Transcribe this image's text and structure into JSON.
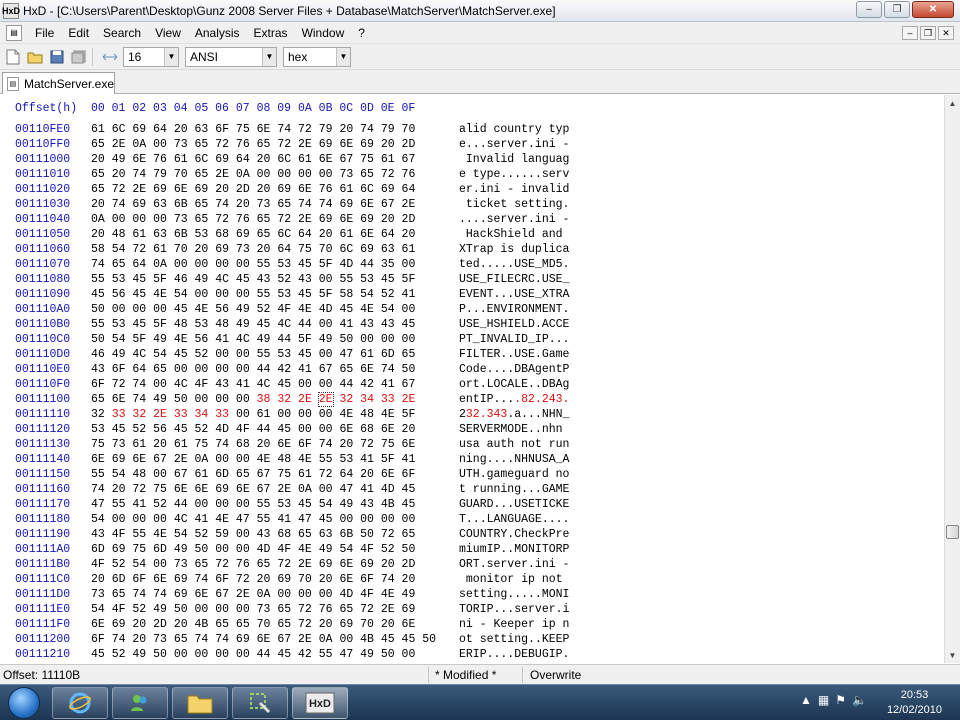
{
  "window": {
    "app_icon": "HxD",
    "title": "HxD - [C:\\Users\\Parent\\Desktop\\Gunz 2008 Server Files + Database\\MatchServer\\MatchServer.exe]",
    "buttons": {
      "minimize": "–",
      "maximize": "❐",
      "close": "✕"
    }
  },
  "menu": {
    "items": [
      "File",
      "Edit",
      "Search",
      "View",
      "Analysis",
      "Extras",
      "Window",
      "?"
    ],
    "mdi_buttons": {
      "minimize": "–",
      "restore": "❐",
      "close": "✕"
    }
  },
  "toolbar": {
    "bytes_per_row": "16",
    "charset": "ANSI",
    "base": "hex"
  },
  "tab": {
    "label": "MatchServer.exe"
  },
  "hex_view": {
    "header_offset": "Offset(h)",
    "header_columns": "00 01 02 03 04 05 06 07 08 09 0A 0B 0C 0D 0E 0F",
    "rows": [
      {
        "offset": "00110FE0",
        "hex": "61 6C 69 64 20 63 6F 75 6E 74 72 79 20 74 79 70",
        "ascii": "alid country typ"
      },
      {
        "offset": "00110FF0",
        "hex": "65 2E 0A 00 73 65 72 76 65 72 2E 69 6E 69 20 2D",
        "ascii": "e...server.ini -"
      },
      {
        "offset": "00111000",
        "hex": "20 49 6E 76 61 6C 69 64 20 6C 61 6E 67 75 61 67",
        "ascii": " Invalid languag"
      },
      {
        "offset": "00111010",
        "hex": "65 20 74 79 70 65 2E 0A 00 00 00 00 73 65 72 76",
        "ascii": "e type......serv"
      },
      {
        "offset": "00111020",
        "hex": "65 72 2E 69 6E 69 20 2D 20 69 6E 76 61 6C 69 64",
        "ascii": "er.ini - invalid"
      },
      {
        "offset": "00111030",
        "hex": "20 74 69 63 6B 65 74 20 73 65 74 74 69 6E 67 2E",
        "ascii": " ticket setting."
      },
      {
        "offset": "00111040",
        "hex": "0A 00 00 00 73 65 72 76 65 72 2E 69 6E 69 20 2D",
        "ascii": "....server.ini -"
      },
      {
        "offset": "00111050",
        "hex": "20 48 61 63 6B 53 68 69 65 6C 64 20 61 6E 64 20",
        "ascii": " HackShield and "
      },
      {
        "offset": "00111060",
        "hex": "58 54 72 61 70 20 69 73 20 64 75 70 6C 69 63 61",
        "ascii": "XTrap is duplica"
      },
      {
        "offset": "00111070",
        "hex": "74 65 64 0A 00 00 00 00 55 53 45 5F 4D 44 35 00",
        "ascii": "ted.....USE_MD5."
      },
      {
        "offset": "00111080",
        "hex": "55 53 45 5F 46 49 4C 45 43 52 43 00 55 53 45 5F",
        "ascii": "USE_FILECRC.USE_"
      },
      {
        "offset": "00111090",
        "hex": "45 56 45 4E 54 00 00 00 55 53 45 5F 58 54 52 41",
        "ascii": "EVENT...USE_XTRA"
      },
      {
        "offset": "001110A0",
        "hex": "50 00 00 00 45 4E 56 49 52 4F 4E 4D 45 4E 54 00",
        "ascii": "P...ENVIRONMENT."
      },
      {
        "offset": "001110B0",
        "hex": "55 53 45 5F 48 53 48 49 45 4C 44 00 41 43 43 45",
        "ascii": "USE_HSHIELD.ACCE"
      },
      {
        "offset": "001110C0",
        "hex": "50 54 5F 49 4E 56 41 4C 49 44 5F 49 50 00 00 00",
        "ascii": "PT_INVALID_IP..."
      },
      {
        "offset": "001110D0",
        "hex": "46 49 4C 54 45 52 00 00 55 53 45 00 47 61 6D 65",
        "ascii": "FILTER..USE.Game"
      },
      {
        "offset": "001110E0",
        "hex": "43 6F 64 65 00 00 00 00 44 42 41 67 65 6E 74 50",
        "ascii": "Code....DBAgentP"
      },
      {
        "offset": "001110F0",
        "hex": "6F 72 74 00 4C 4F 43 41 4C 45 00 00 44 42 41 67",
        "ascii": "ort.LOCALE..DBAg"
      },
      {
        "offset": "00111100",
        "hex_pre": "65 6E 74 49 50 00 00 00 ",
        "hex_hl": "38 32 2E ",
        "hex_box": "2E",
        "hex_post": " 32 34 33 2E",
        "ascii_pre": "entIP...",
        "ascii_hl": ".82.",
        "ascii_post": "243."
      },
      {
        "offset": "00111110",
        "hex_pre": "32 ",
        "hex_hl": "33 32 2E 33 34 33",
        "hex_post": " 00 61 00 00 00 4E 48 4E 5F",
        "ascii_pre": "2",
        "ascii_hl": "32.343",
        "ascii_post": ".a...NHN_"
      },
      {
        "offset": "00111120",
        "hex": "53 45 52 56 45 52 4D 4F 44 45 00 00 6E 68 6E 20",
        "ascii": "SERVERMODE..nhn "
      },
      {
        "offset": "00111130",
        "hex": "75 73 61 20 61 75 74 68 20 6E 6F 74 20 72 75 6E",
        "ascii": "usa auth not run"
      },
      {
        "offset": "00111140",
        "hex": "6E 69 6E 67 2E 0A 00 00 4E 48 4E 55 53 41 5F 41",
        "ascii": "ning....NHNUSA_A"
      },
      {
        "offset": "00111150",
        "hex": "55 54 48 00 67 61 6D 65 67 75 61 72 64 20 6E 6F",
        "ascii": "UTH.gameguard no"
      },
      {
        "offset": "00111160",
        "hex": "74 20 72 75 6E 6E 69 6E 67 2E 0A 00 47 41 4D 45",
        "ascii": "t running...GAME"
      },
      {
        "offset": "00111170",
        "hex": "47 55 41 52 44 00 00 00 55 53 45 54 49 43 4B 45",
        "ascii": "GUARD...USETICKE"
      },
      {
        "offset": "00111180",
        "hex": "54 00 00 00 4C 41 4E 47 55 41 47 45 00 00 00 00",
        "ascii": "T...LANGUAGE...."
      },
      {
        "offset": "00111190",
        "hex": "43 4F 55 4E 54 52 59 00 43 68 65 63 6B 50 72 65",
        "ascii": "COUNTRY.CheckPre"
      },
      {
        "offset": "001111A0",
        "hex": "6D 69 75 6D 49 50 00 00 4D 4F 4E 49 54 4F 52 50",
        "ascii": "miumIP..MONITORP"
      },
      {
        "offset": "001111B0",
        "hex": "4F 52 54 00 73 65 72 76 65 72 2E 69 6E 69 20 2D",
        "ascii": "ORT.server.ini -"
      },
      {
        "offset": "001111C0",
        "hex": "20 6D 6F 6E 69 74 6F 72 20 69 70 20 6E 6F 74 20",
        "ascii": " monitor ip not "
      },
      {
        "offset": "001111D0",
        "hex": "73 65 74 74 69 6E 67 2E 0A 00 00 00 4D 4F 4E 49",
        "ascii": "setting.....MONI"
      },
      {
        "offset": "001111E0",
        "hex": "54 4F 52 49 50 00 00 00 73 65 72 76 65 72 2E 69",
        "ascii": "TORIP...server.i"
      },
      {
        "offset": "001111F0",
        "hex": "6E 69 20 2D 20 4B 65 65 70 65 72 20 69 70 20 6E",
        "ascii": "ni - Keeper ip n"
      },
      {
        "offset": "00111200",
        "hex": "6F 74 20 73 65 74 74 69 6E 67 2E 0A 00 4B 45 45 50",
        "ascii": "ot setting..KEEP"
      },
      {
        "offset": "00111210",
        "hex": "45 52 49 50 00 00 00 00 44 45 42 55 47 49 50 00",
        "ascii": "ERIP....DEBUGIP."
      }
    ]
  },
  "status": {
    "offset": "Offset: 11110B",
    "modified": "* Modified *",
    "mode": "Overwrite"
  },
  "taskbar": {
    "clock_time": "20:53",
    "clock_date": "12/02/2010"
  },
  "colors": {
    "offset_blue": "#1515b8",
    "modified_red": "#dd1111"
  }
}
